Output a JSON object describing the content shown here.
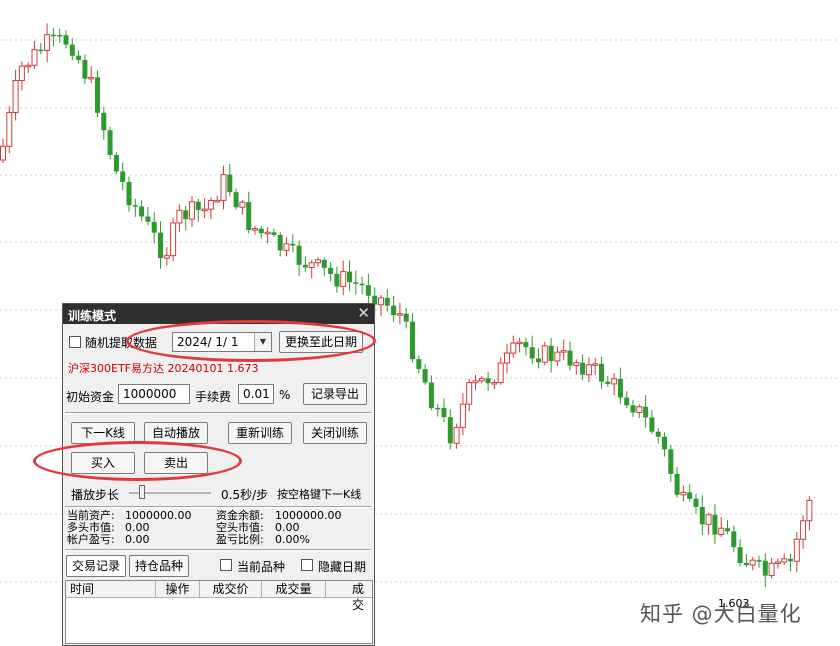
{
  "chart_data": {
    "type": "candlestick",
    "up_color": "#d03c3c",
    "down_color": "#2e9a2e",
    "grid": true,
    "price_label": "1.603"
  },
  "panel": {
    "title": "训练模式",
    "close_glyph": "✕",
    "random_label": "随机提取数据",
    "date_value": "2024/ 1/ 1",
    "switch_date_button": "更换至此日期",
    "instrument_info": "沪深300ETF易方达 20240101 1.673",
    "initial_capital_label": "初始资金",
    "initial_capital_value": "1000000",
    "fee_label": "手续费",
    "fee_value": "0.01",
    "fee_unit": "%",
    "export_button": "记录导出",
    "next_k_button": "下一K线",
    "autoplay_button": "自动播放",
    "retrain_button": "重新训练",
    "close_train_button": "关闭训练",
    "buy_button": "买入",
    "sell_button": "卖出",
    "step_label": "播放步长",
    "step_value": "0.5秒/步",
    "step_hint": "按空格键下一K线",
    "current_assets_label": "当前资产:",
    "current_assets_value": "1000000.00",
    "cash_balance_label": "资金余额:",
    "cash_balance_value": "1000000.00",
    "long_value_label": "多头市值:",
    "long_value": "0.00",
    "short_value_label": "空头市值:",
    "short_value": "0.00",
    "account_pl_label": "帐户盈亏:",
    "account_pl_value": "0.00",
    "pl_ratio_label": "盈亏比例:",
    "pl_ratio_value": "0.00%",
    "tab_trades": "交易记录",
    "tab_holdings": "持仓品种",
    "current_product_label": "当前品种",
    "hide_date_label": "隐藏日期",
    "table_headers": [
      "时间",
      "操作",
      "成交价",
      "成交量",
      "成交"
    ]
  },
  "watermark": "知乎 @大白量化"
}
